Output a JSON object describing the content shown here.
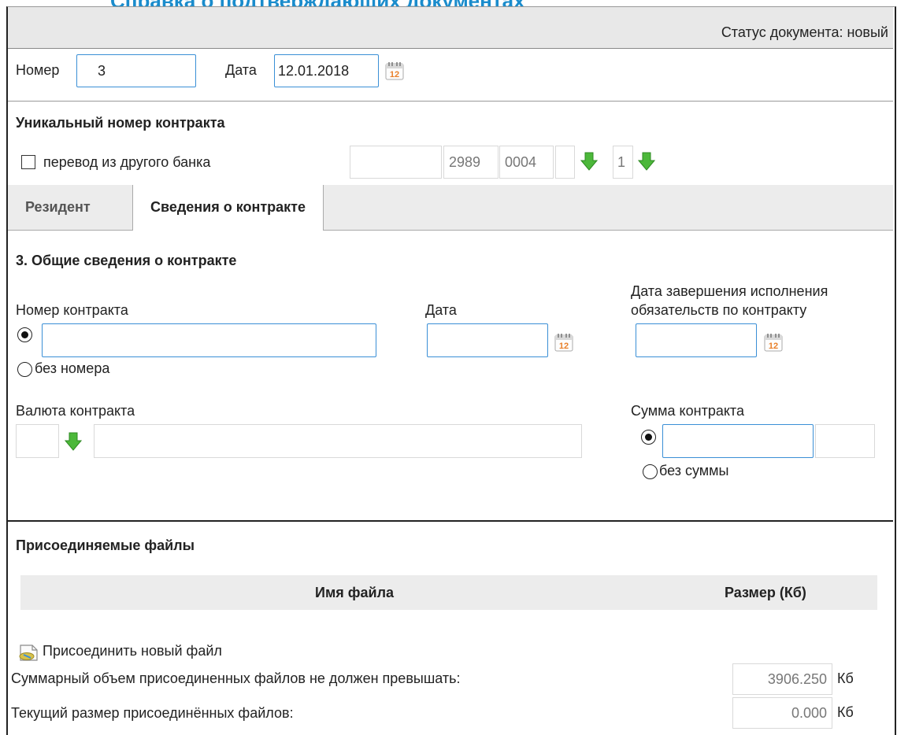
{
  "page": {
    "title": "Справка о подтверждающих документах"
  },
  "status": {
    "text": "Статус документа: новый"
  },
  "header": {
    "number_label": "Номер",
    "number_value": "3",
    "date_label": "Дата",
    "date_value": "12.01.2018"
  },
  "unique_contract": {
    "title": "Уникальный номер контракта",
    "transfer_label": "перевод из другого банка",
    "transfer_checked": false,
    "field1": "",
    "field2": "2989",
    "field3": "0004",
    "field4": "",
    "field5": "1"
  },
  "tabs": [
    {
      "label": "Резидент",
      "active": false
    },
    {
      "label": "Сведения о контракте",
      "active": true
    }
  ],
  "contract": {
    "section_title": "3. Общие сведения о контракте",
    "number_label": "Номер контракта",
    "number_value": "",
    "no_number_label": "без номера",
    "date_label": "Дата",
    "date_value": "",
    "completion_label_line1": "Дата завершения исполнения",
    "completion_label_line2": "обязательств по контракту",
    "completion_value": "",
    "currency_label": "Валюта контракта",
    "currency_code": "",
    "currency_name": "",
    "amount_label": "Сумма контракта",
    "amount_value": "",
    "amount_extra": "",
    "no_amount_label": "без суммы"
  },
  "files": {
    "title": "Присоединяемые файлы",
    "col_name": "Имя файла",
    "col_size": "Размер (Кб)",
    "attach_label": "Присоединить новый файл",
    "max_label": "Суммарный объем присоединенных файлов не должен превышать:",
    "max_value": "3906.250",
    "current_label": "Текущий размер присоединённых файлов:",
    "current_value": "0.000",
    "unit": "Кб"
  },
  "colors": {
    "accent": "#1a8ccc",
    "focus_border": "#3a8fd6",
    "arrow_green": "#4cb83a",
    "calendar_orange": "#e9802a"
  }
}
